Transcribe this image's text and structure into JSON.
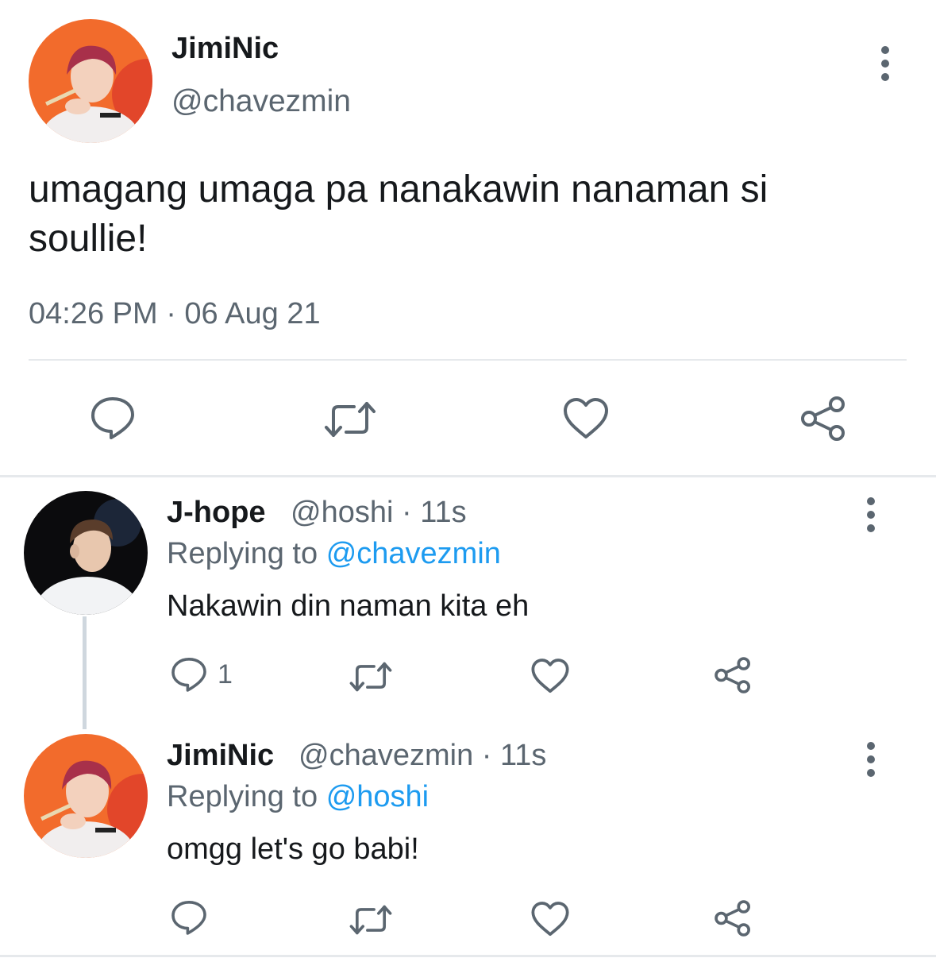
{
  "main_tweet": {
    "display_name": "JimiNic",
    "handle": "@chavezmin",
    "text": "umagang umaga pa nanakawin nanaman si soullie!",
    "timestamp": "04:26 PM · 06 Aug 21",
    "actions": [
      "reply-icon",
      "retweet-icon",
      "like-icon",
      "share-icon"
    ]
  },
  "replies": [
    {
      "display_name": "J-hope",
      "meta": "@hoshi · 11s",
      "replying_prefix": "Replying to",
      "replying_to": "@chavezmin",
      "text": "Nakawin din naman kita eh",
      "reply_count": "1"
    },
    {
      "display_name": "JimiNic",
      "meta": "@chavezmin · 11s",
      "replying_prefix": "Replying to",
      "replying_to": "@hoshi",
      "text": "omgg let's go babi!",
      "reply_count": ""
    }
  ],
  "colors": {
    "accent": "#1d9bf0",
    "muted": "#5b6670",
    "avatar_jiminic_bg": "#f26b2c",
    "avatar_jhope_bg": "#0b0b0d"
  }
}
